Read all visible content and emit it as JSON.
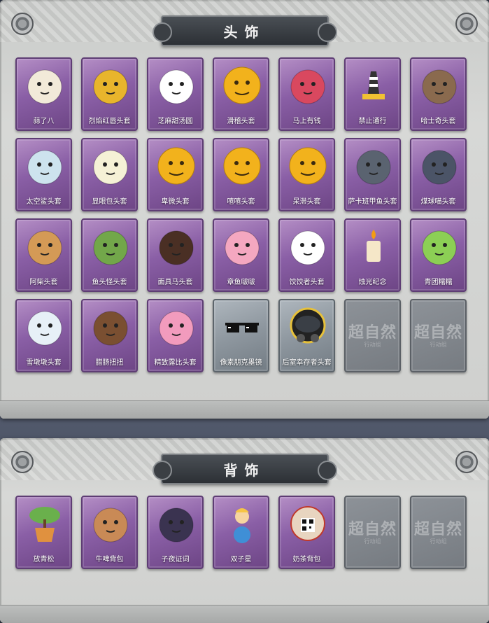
{
  "sections": {
    "head": {
      "title": "头饰",
      "items": [
        {
          "label": "蒜了八",
          "icon": "garlic-face-icon",
          "color": "#f2ead9"
        },
        {
          "label": "烈焰红唇头套",
          "icon": "pikachu-sunglasses-icon",
          "color": "#e8b52c"
        },
        {
          "label": "芝麻甜汤圆",
          "icon": "rice-ball-face-icon",
          "color": "#ffffff"
        },
        {
          "label": "滑稽头套",
          "icon": "smirk-emoji-icon",
          "color": "#f2b21c"
        },
        {
          "label": "马上有钱",
          "icon": "red-horse-icon",
          "color": "#d9485f"
        },
        {
          "label": "禁止通行",
          "icon": "road-barrier-icon",
          "color": "#444444"
        },
        {
          "label": "哈士奇头套",
          "icon": "husky-sunglasses-icon",
          "color": "#8a6a4e"
        },
        {
          "label": "太空鲨头套",
          "icon": "shark-head-icon",
          "color": "#cde3ee"
        },
        {
          "label": "显眼包头套",
          "icon": "light-bulb-crown-icon",
          "color": "#f5f1d6"
        },
        {
          "label": "卑微头套",
          "icon": "humble-emoji-icon",
          "color": "#f2b21c"
        },
        {
          "label": "嘻嘻头套",
          "icon": "grin-emoji-icon",
          "color": "#f2b21c"
        },
        {
          "label": "呆滞头套",
          "icon": "stare-emoji-icon",
          "color": "#f2b21c"
        },
        {
          "label": "萨卡班甲鱼头套",
          "icon": "fish-head-icon",
          "color": "#5a6370"
        },
        {
          "label": "煤球喵头套",
          "icon": "gray-cat-icon",
          "color": "#4b5467"
        },
        {
          "label": "阿柴头套",
          "icon": "shiba-dog-icon",
          "color": "#d49a56"
        },
        {
          "label": "鱼头怪头套",
          "icon": "fish-monster-icon",
          "color": "#72a74a"
        },
        {
          "label": "面具马头套",
          "icon": "horse-mask-icon",
          "color": "#4a2f24"
        },
        {
          "label": "章鱼啵啵",
          "icon": "pink-octopus-icon",
          "color": "#f4a7c0"
        },
        {
          "label": "饺饺者头套",
          "icon": "cloud-face-icon",
          "color": "#ffffff"
        },
        {
          "label": "烛光纪念",
          "icon": "candle-icon",
          "color": "#f5e7c8"
        },
        {
          "label": "青团糯糯",
          "icon": "green-rice-ball-icon",
          "color": "#8ccf55"
        },
        {
          "label": "雪墩墩头套",
          "icon": "snowman-hat-icon",
          "color": "#e7f0f7"
        },
        {
          "label": "腊肠扭扭",
          "icon": "sausage-dog-icon",
          "color": "#7a4f31"
        },
        {
          "label": "精致露比头套",
          "icon": "pink-beaver-icon",
          "color": "#f29bbd"
        },
        {
          "label": "像素朋克墨镜",
          "icon": "pixel-sunglasses-icon",
          "color": "#111111",
          "frame": "gray"
        },
        {
          "label": "后室幸存者头套",
          "icon": "gas-mask-helmet-icon",
          "color": "#2b2b2b",
          "frame": "gray"
        },
        {
          "label": "",
          "icon": "empty-slot-icon",
          "empty": true
        },
        {
          "label": "",
          "icon": "empty-slot-icon",
          "empty": true
        }
      ]
    },
    "back": {
      "title": "背饰",
      "items": [
        {
          "label": "放青松",
          "icon": "bonsai-pot-icon",
          "color": "#6ab04c"
        },
        {
          "label": "牛啤背包",
          "icon": "cow-beer-barrel-icon",
          "color": "#c98a56"
        },
        {
          "label": "子夜证词",
          "icon": "dark-wings-doll-icon",
          "color": "#3a3350"
        },
        {
          "label": "双子星",
          "icon": "twin-star-planet-icon",
          "color": "#f6c545"
        },
        {
          "label": "奶茶背包",
          "icon": "milk-tea-qr-icon",
          "color": "#e8d5c0"
        },
        {
          "label": "",
          "icon": "empty-slot-icon",
          "empty": true
        },
        {
          "label": "",
          "icon": "empty-slot-icon",
          "empty": true
        }
      ]
    },
    "empty_watermark": "超自然",
    "empty_watermark_sub": "行动组"
  }
}
